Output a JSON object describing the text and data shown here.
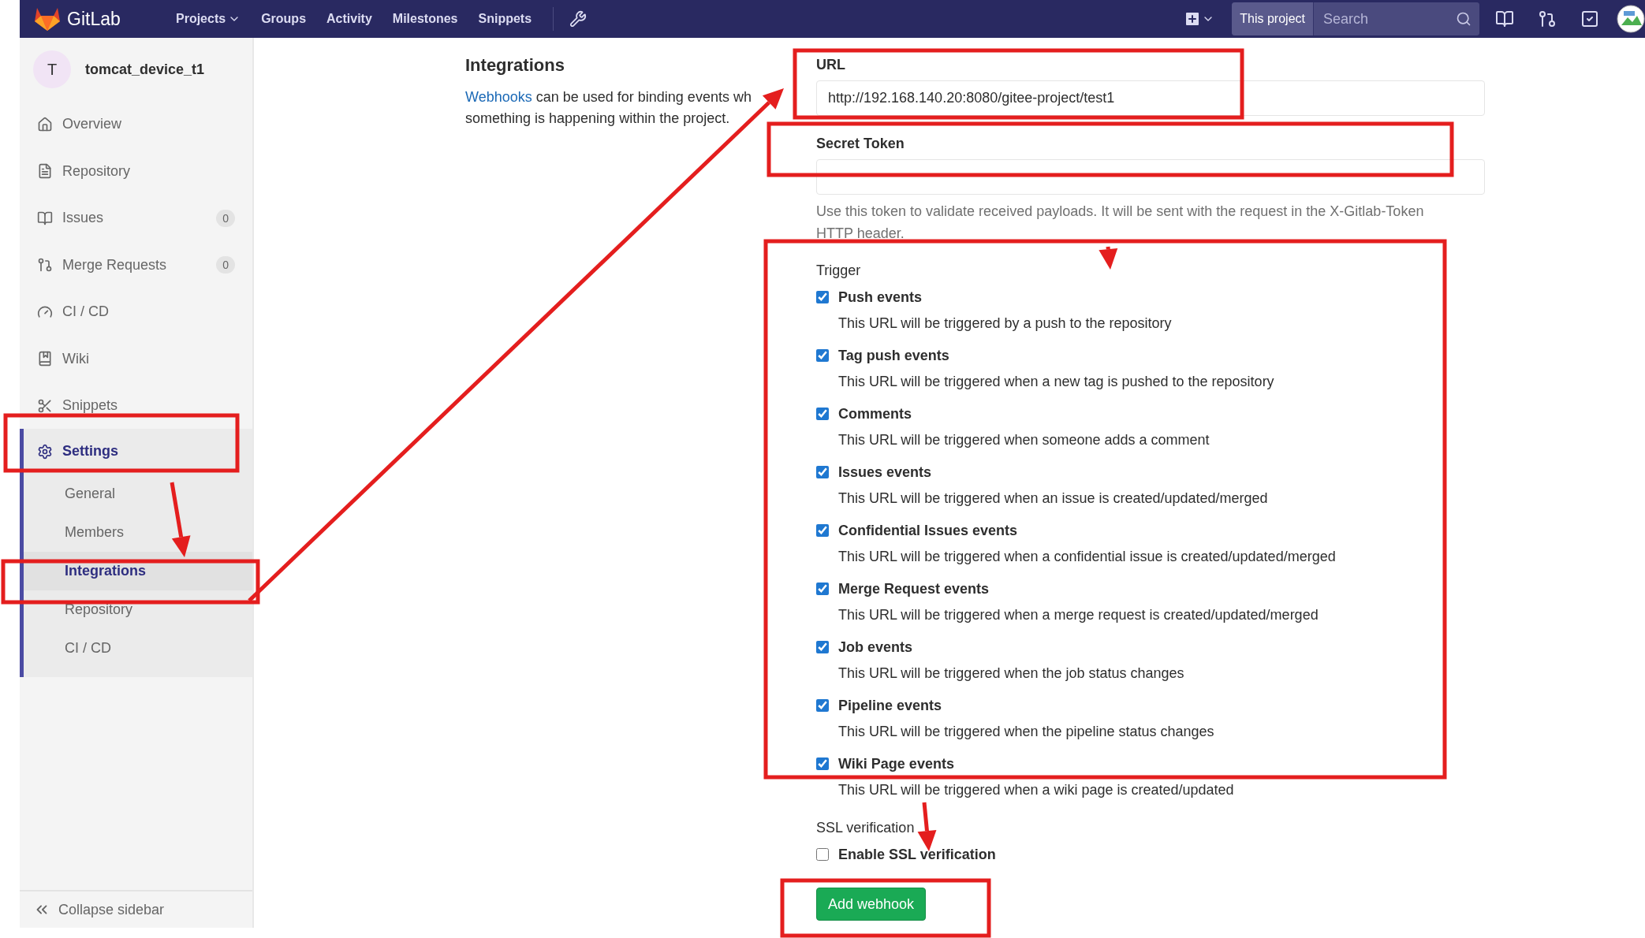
{
  "navbar": {
    "brand": "GitLab",
    "links": [
      {
        "label": "Projects",
        "dropdown": true
      },
      {
        "label": "Groups",
        "dropdown": false
      },
      {
        "label": "Activity",
        "dropdown": false
      },
      {
        "label": "Milestones",
        "dropdown": false
      },
      {
        "label": "Snippets",
        "dropdown": false
      }
    ],
    "search_scope": "This project",
    "search": {
      "placeholder": "Search"
    }
  },
  "sidebar": {
    "project": {
      "initial": "T",
      "name": "tomcat_device_t1"
    },
    "items": [
      {
        "label": "Overview",
        "selected": false
      },
      {
        "label": "Repository",
        "selected": false
      },
      {
        "label": "Issues",
        "badge": "0",
        "selected": false
      },
      {
        "label": "Merge Requests",
        "badge": "0",
        "selected": false
      },
      {
        "label": "CI / CD",
        "selected": false
      },
      {
        "label": "Wiki",
        "selected": false
      },
      {
        "label": "Snippets",
        "selected": false
      },
      {
        "label": "Settings",
        "selected": true,
        "children": [
          {
            "label": "General",
            "selected": false
          },
          {
            "label": "Members",
            "selected": false
          },
          {
            "label": "Integrations",
            "selected": true
          },
          {
            "label": "Repository",
            "selected": false
          },
          {
            "label": "CI / CD",
            "selected": false
          }
        ]
      }
    ],
    "collapse": "Collapse sidebar"
  },
  "section": {
    "title": "Integrations",
    "link": "Webhooks",
    "line_1": "can be used for binding events wh",
    "line_2": "something is happening within the project."
  },
  "form": {
    "url": {
      "label": "URL",
      "value": "http://192.168.140.20:8080/gitee-project/test1"
    },
    "secret_token": {
      "label": "Secret Token"
    },
    "help": "Use this token to validate received payloads. It will be sent with the request in the X-Gitlab-Token HTTP header.",
    "trigger": {
      "label": "Trigger",
      "events": [
        {
          "label": "Push events",
          "description": "This URL will be triggered by a push to the repository",
          "checked": true
        },
        {
          "label": "Tag push events",
          "description": "This URL will be triggered when a new tag is pushed to the repository",
          "checked": true
        },
        {
          "label": "Comments",
          "description": "This URL will be triggered when someone adds a comment",
          "checked": true
        },
        {
          "label": "Issues events",
          "description": "This URL will be triggered when an issue is created/updated/merged",
          "checked": true
        },
        {
          "label": "Confidential Issues events",
          "description": "This URL will be triggered when a confidential issue is created/updated/merged",
          "checked": true
        },
        {
          "label": "Merge Request events",
          "description": "This URL will be triggered when a merge request is created/updated/merged",
          "checked": true
        },
        {
          "label": "Job events",
          "description": "This URL will be triggered when the job status changes",
          "checked": true
        },
        {
          "label": "Pipeline events",
          "description": "This URL will be triggered when the pipeline status changes",
          "checked": true
        },
        {
          "label": "Wiki Page events",
          "description": "This URL will be triggered when a wiki page is created/updated",
          "checked": true
        }
      ]
    },
    "ssl": {
      "label": "SSL verification",
      "option": {
        "label": "Enable SSL verification",
        "checked": false
      }
    },
    "submit": "Add webhook"
  }
}
